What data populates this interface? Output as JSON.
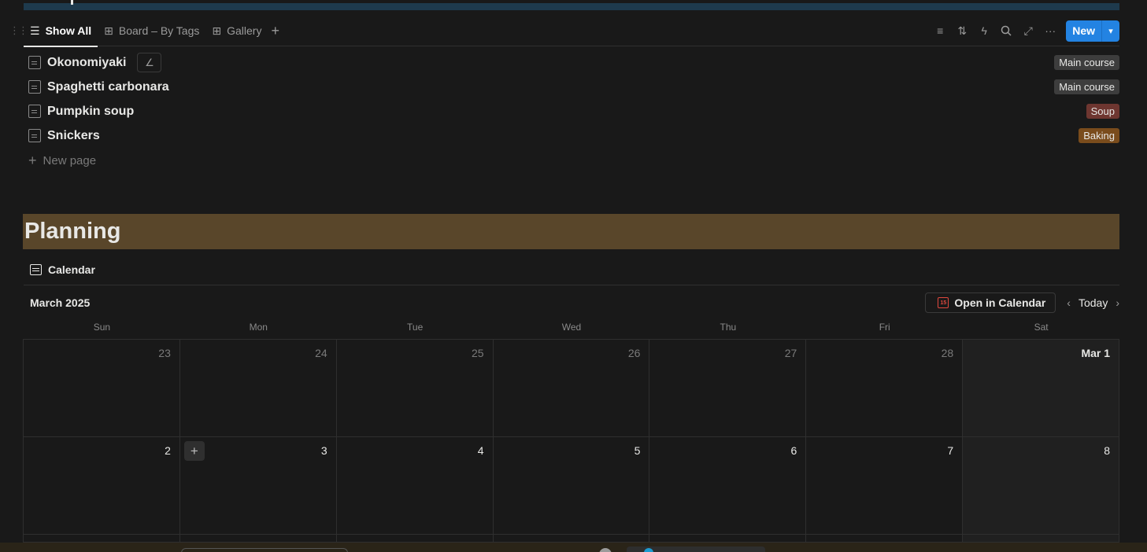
{
  "views": {
    "tabs": [
      {
        "label": "Show All",
        "icon": "list-icon",
        "active": true
      },
      {
        "label": "Board – By Tags",
        "icon": "board-icon",
        "active": false
      },
      {
        "label": "Gallery",
        "icon": "gallery-icon",
        "active": false
      }
    ],
    "new_label": "New"
  },
  "recipes": [
    {
      "title": "Okonomiyaki",
      "tag": "Main course",
      "tag_color": "#3d3d3d"
    },
    {
      "title": "Spaghetti carbonara",
      "tag": "Main course",
      "tag_color": "#3d3d3d"
    },
    {
      "title": "Pumpkin soup",
      "tag": "Soup",
      "tag_color": "#6e3630"
    },
    {
      "title": "Snickers",
      "tag": "Baking",
      "tag_color": "#7a4c1c"
    }
  ],
  "new_page_label": "New page",
  "planning": {
    "heading": "Planning",
    "heading_bg": "#59462a",
    "view_label": "Calendar",
    "month": "March 2025",
    "open_calendar_label": "Open in Calendar",
    "open_calendar_icon_text": "15",
    "today_label": "Today",
    "weekdays": [
      "Sun",
      "Mon",
      "Tue",
      "Wed",
      "Thu",
      "Fri",
      "Sat"
    ],
    "weeks": [
      [
        "23",
        "24",
        "25",
        "26",
        "27",
        "28",
        "Mar 1"
      ],
      [
        "2",
        "3",
        "4",
        "5",
        "6",
        "7",
        "8"
      ]
    ]
  },
  "accent": "#2383e2"
}
